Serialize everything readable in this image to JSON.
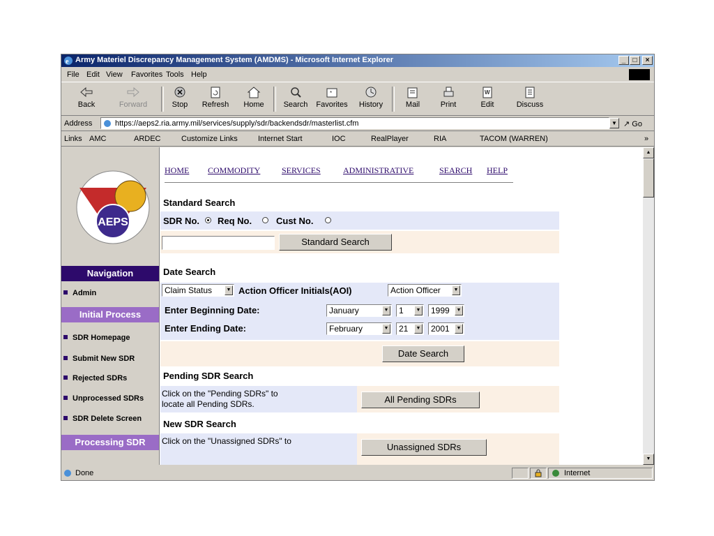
{
  "window": {
    "title": "Army Materiel Discrepancy Management System (AMDMS) - Microsoft Internet Explorer",
    "minimize": "_",
    "maximize": "□",
    "close": "×"
  },
  "menu": [
    "File",
    "Edit",
    "View",
    "Favorites",
    "Tools",
    "Help"
  ],
  "toolbar": {
    "back": "Back",
    "forward": "Forward",
    "stop": "Stop",
    "refresh": "Refresh",
    "home": "Home",
    "search": "Search",
    "favorites": "Favorites",
    "history": "History",
    "mail": "Mail",
    "print": "Print",
    "edit": "Edit",
    "discuss": "Discuss"
  },
  "address": {
    "label": "Address",
    "url": "https://aeps2.ria.army.mil/services/supply/sdr/backendsdr/masterlist.cfm",
    "go": "Go"
  },
  "links": {
    "label": "Links",
    "items": [
      "AMC",
      "ARDEC",
      "Customize Links",
      "Internet Start",
      "IOC",
      "RealPlayer",
      "RIA",
      "TACOM (WARREN)"
    ],
    "more": "»"
  },
  "logo": {
    "text": "AEPS"
  },
  "nav": {
    "header": "Navigation",
    "admin": "Admin",
    "initial_process": "Initial Process",
    "items": [
      "SDR Homepage",
      "Submit New SDR",
      "Rejected SDRs",
      "Unprocessed SDRs",
      "SDR Delete Screen"
    ],
    "processing": "Processing SDR"
  },
  "topnav": [
    "HOME",
    "COMMODITY",
    "SERVICES",
    "ADMINISTRATIVE",
    "SEARCH",
    "HELP"
  ],
  "standard_search": {
    "title": "Standard Search",
    "opt_sdr": "SDR No.",
    "opt_req": "Req No.",
    "opt_cust": "Cust No.",
    "button": "Standard Search",
    "input_value": ""
  },
  "date_search": {
    "title": "Date Search",
    "claim_status": "Claim Status",
    "aoi_label": "Action Officer Initials(AOI)",
    "aoi_select": "Action Officer",
    "begin_label": "Enter Beginning Date:",
    "begin_month": "January",
    "begin_day": "1",
    "begin_year": "1999",
    "end_label": "Enter Ending Date:",
    "end_month": "February",
    "end_day": "21",
    "end_year": "2001",
    "button": "Date Search"
  },
  "pending": {
    "title": "Pending SDR Search",
    "desc1": "Click on the \"Pending SDRs\" to",
    "desc2": "locate all Pending SDRs.",
    "button": "All Pending SDRs"
  },
  "newsdr": {
    "title": "New SDR Search",
    "desc1": "Click on the \"Unassigned SDRs\" to",
    "button": "Unassigned SDRs"
  },
  "status": {
    "text": "Done",
    "zone": "Internet"
  },
  "colors": {
    "nav_dark": "#2d0a6b",
    "nav_light": "#9a6cc6",
    "row_blue": "#e4e8f8",
    "row_peach": "#fbf0e4"
  }
}
